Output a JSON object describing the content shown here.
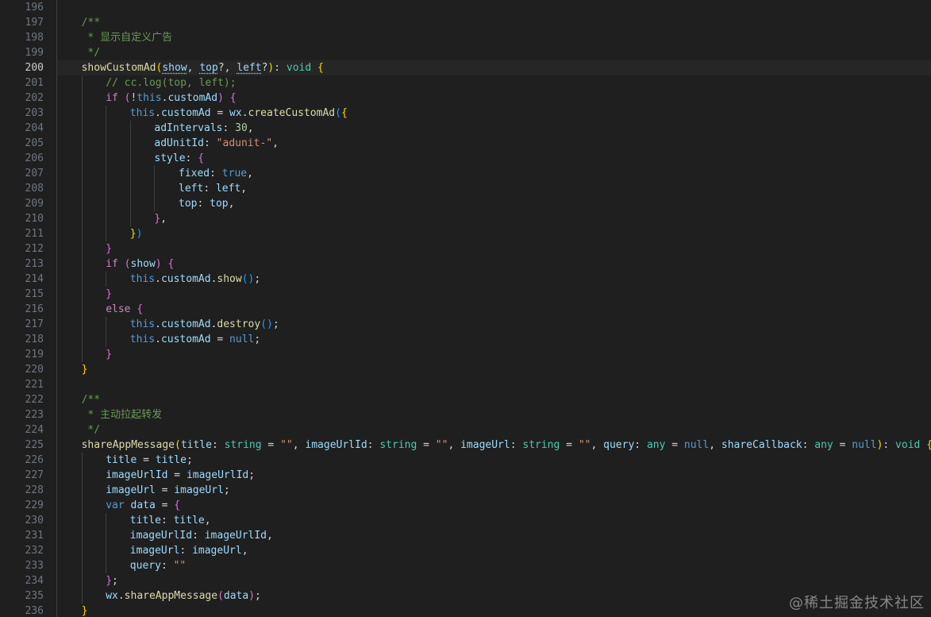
{
  "editor": {
    "theme": {
      "background": "#1f1f1f",
      "line_number": "#6e7681",
      "keyword": "#569cd6",
      "control": "#c586c0",
      "function": "#dcdcaa",
      "variable": "#9cdcfe",
      "type": "#4ec9b0",
      "string": "#ce9178",
      "number": "#b5cea8",
      "comment": "#6a9955",
      "punct": "#d4d4d4",
      "bracket1": "#ffd700",
      "bracket2": "#da70d6",
      "bracket3": "#179fff"
    },
    "active_line": 200,
    "lines": [
      {
        "n": "196",
        "indent": 0,
        "tokens": []
      },
      {
        "n": "197",
        "indent": 1,
        "tokens": [
          [
            "/**",
            "comment"
          ]
        ]
      },
      {
        "n": "198",
        "indent": 1,
        "tokens": [
          [
            " * 显示自定义广告",
            "comment"
          ]
        ]
      },
      {
        "n": "199",
        "indent": 1,
        "tokens": [
          [
            " */",
            "comment"
          ]
        ]
      },
      {
        "n": "200",
        "indent": 1,
        "tokens": [
          [
            "showCustomAd",
            "function"
          ],
          [
            "(",
            "bracket1"
          ],
          [
            "show",
            "variable",
            "squiggle"
          ],
          [
            ", ",
            "punct"
          ],
          [
            "top",
            "variable",
            "squiggle"
          ],
          [
            "?, ",
            "punct"
          ],
          [
            "left",
            "variable",
            "squiggle"
          ],
          [
            "?",
            "punct"
          ],
          [
            ")",
            "bracket1"
          ],
          [
            ": ",
            "punct"
          ],
          [
            "void",
            "type"
          ],
          [
            " ",
            "punct"
          ],
          [
            "{",
            "bracket1"
          ]
        ]
      },
      {
        "n": "201",
        "indent": 2,
        "tokens": [
          [
            "// cc.log(top, left);",
            "comment"
          ]
        ]
      },
      {
        "n": "202",
        "indent": 2,
        "tokens": [
          [
            "if",
            "control"
          ],
          [
            " ",
            "punct"
          ],
          [
            "(",
            "bracket2"
          ],
          [
            "!",
            "punct"
          ],
          [
            "this",
            "keyword"
          ],
          [
            ".",
            "punct"
          ],
          [
            "customAd",
            "variable"
          ],
          [
            ")",
            "bracket2"
          ],
          [
            " ",
            "punct"
          ],
          [
            "{",
            "bracket2"
          ]
        ]
      },
      {
        "n": "203",
        "indent": 3,
        "tokens": [
          [
            "this",
            "keyword"
          ],
          [
            ".",
            "punct"
          ],
          [
            "customAd",
            "variable"
          ],
          [
            " = ",
            "punct"
          ],
          [
            "wx",
            "variable"
          ],
          [
            ".",
            "punct"
          ],
          [
            "createCustomAd",
            "function"
          ],
          [
            "(",
            "bracket3"
          ],
          [
            "{",
            "bracket1"
          ]
        ]
      },
      {
        "n": "204",
        "indent": 4,
        "tokens": [
          [
            "adIntervals",
            "variable"
          ],
          [
            ": ",
            "punct"
          ],
          [
            "30",
            "number"
          ],
          [
            ",",
            "punct"
          ]
        ]
      },
      {
        "n": "205",
        "indent": 4,
        "tokens": [
          [
            "adUnitId",
            "variable"
          ],
          [
            ": ",
            "punct"
          ],
          [
            "\"adunit-\"",
            "string"
          ],
          [
            ",",
            "punct"
          ]
        ]
      },
      {
        "n": "206",
        "indent": 4,
        "tokens": [
          [
            "style",
            "variable"
          ],
          [
            ": ",
            "punct"
          ],
          [
            "{",
            "bracket2"
          ]
        ]
      },
      {
        "n": "207",
        "indent": 5,
        "tokens": [
          [
            "fixed",
            "variable"
          ],
          [
            ": ",
            "punct"
          ],
          [
            "true",
            "keyword"
          ],
          [
            ",",
            "punct"
          ]
        ]
      },
      {
        "n": "208",
        "indent": 5,
        "tokens": [
          [
            "left",
            "variable"
          ],
          [
            ": ",
            "punct"
          ],
          [
            "left",
            "variable"
          ],
          [
            ",",
            "punct"
          ]
        ]
      },
      {
        "n": "209",
        "indent": 5,
        "tokens": [
          [
            "top",
            "variable"
          ],
          [
            ": ",
            "punct"
          ],
          [
            "top",
            "variable"
          ],
          [
            ",",
            "punct"
          ]
        ]
      },
      {
        "n": "210",
        "indent": 4,
        "tokens": [
          [
            "}",
            "bracket2"
          ],
          [
            ",",
            "punct"
          ]
        ]
      },
      {
        "n": "211",
        "indent": 3,
        "tokens": [
          [
            "}",
            "bracket1"
          ],
          [
            ")",
            "bracket3"
          ]
        ]
      },
      {
        "n": "212",
        "indent": 2,
        "tokens": [
          [
            "}",
            "bracket2"
          ]
        ]
      },
      {
        "n": "213",
        "indent": 2,
        "tokens": [
          [
            "if",
            "control"
          ],
          [
            " ",
            "punct"
          ],
          [
            "(",
            "bracket2"
          ],
          [
            "show",
            "variable"
          ],
          [
            ")",
            "bracket2"
          ],
          [
            " ",
            "punct"
          ],
          [
            "{",
            "bracket2"
          ]
        ]
      },
      {
        "n": "214",
        "indent": 3,
        "tokens": [
          [
            "this",
            "keyword"
          ],
          [
            ".",
            "punct"
          ],
          [
            "customAd",
            "variable"
          ],
          [
            ".",
            "punct"
          ],
          [
            "show",
            "function"
          ],
          [
            "()",
            "bracket3"
          ],
          [
            ";",
            "punct"
          ]
        ]
      },
      {
        "n": "215",
        "indent": 2,
        "tokens": [
          [
            "}",
            "bracket2"
          ]
        ]
      },
      {
        "n": "216",
        "indent": 2,
        "tokens": [
          [
            "else",
            "control"
          ],
          [
            " ",
            "punct"
          ],
          [
            "{",
            "bracket2"
          ]
        ]
      },
      {
        "n": "217",
        "indent": 3,
        "tokens": [
          [
            "this",
            "keyword"
          ],
          [
            ".",
            "punct"
          ],
          [
            "customAd",
            "variable"
          ],
          [
            ".",
            "punct"
          ],
          [
            "destroy",
            "function"
          ],
          [
            "()",
            "bracket3"
          ],
          [
            ";",
            "punct"
          ]
        ]
      },
      {
        "n": "218",
        "indent": 3,
        "tokens": [
          [
            "this",
            "keyword"
          ],
          [
            ".",
            "punct"
          ],
          [
            "customAd",
            "variable"
          ],
          [
            " = ",
            "punct"
          ],
          [
            "null",
            "keyword"
          ],
          [
            ";",
            "punct"
          ]
        ]
      },
      {
        "n": "219",
        "indent": 2,
        "tokens": [
          [
            "}",
            "bracket2"
          ]
        ]
      },
      {
        "n": "220",
        "indent": 1,
        "tokens": [
          [
            "}",
            "bracket1"
          ]
        ]
      },
      {
        "n": "221",
        "indent": 0,
        "tokens": []
      },
      {
        "n": "222",
        "indent": 1,
        "tokens": [
          [
            "/**",
            "comment"
          ]
        ]
      },
      {
        "n": "223",
        "indent": 1,
        "tokens": [
          [
            " * 主动拉起转发",
            "comment"
          ]
        ]
      },
      {
        "n": "224",
        "indent": 1,
        "tokens": [
          [
            " */",
            "comment"
          ]
        ]
      },
      {
        "n": "225",
        "indent": 1,
        "tokens": [
          [
            "shareAppMessage",
            "function"
          ],
          [
            "(",
            "bracket1"
          ],
          [
            "title",
            "variable"
          ],
          [
            ": ",
            "punct"
          ],
          [
            "string",
            "type"
          ],
          [
            " = ",
            "punct"
          ],
          [
            "\"\"",
            "string"
          ],
          [
            ", ",
            "punct"
          ],
          [
            "imageUrlId",
            "variable"
          ],
          [
            ": ",
            "punct"
          ],
          [
            "string",
            "type"
          ],
          [
            " = ",
            "punct"
          ],
          [
            "\"\"",
            "string"
          ],
          [
            ", ",
            "punct"
          ],
          [
            "imageUrl",
            "variable"
          ],
          [
            ": ",
            "punct"
          ],
          [
            "string",
            "type"
          ],
          [
            " = ",
            "punct"
          ],
          [
            "\"\"",
            "string"
          ],
          [
            ", ",
            "punct"
          ],
          [
            "query",
            "variable"
          ],
          [
            ": ",
            "punct"
          ],
          [
            "any",
            "type"
          ],
          [
            " = ",
            "punct"
          ],
          [
            "null",
            "keyword"
          ],
          [
            ", ",
            "punct"
          ],
          [
            "shareCallback",
            "variable"
          ],
          [
            ": ",
            "punct"
          ],
          [
            "any",
            "type"
          ],
          [
            " = ",
            "punct"
          ],
          [
            "null",
            "keyword"
          ],
          [
            ")",
            "bracket1"
          ],
          [
            ": ",
            "punct"
          ],
          [
            "void",
            "type"
          ],
          [
            " ",
            "punct"
          ],
          [
            "{",
            "bracket1"
          ]
        ]
      },
      {
        "n": "226",
        "indent": 2,
        "tokens": [
          [
            "title",
            "variable"
          ],
          [
            " = ",
            "punct"
          ],
          [
            "title",
            "variable"
          ],
          [
            ";",
            "punct"
          ]
        ]
      },
      {
        "n": "227",
        "indent": 2,
        "tokens": [
          [
            "imageUrlId",
            "variable"
          ],
          [
            " = ",
            "punct"
          ],
          [
            "imageUrlId",
            "variable"
          ],
          [
            ";",
            "punct"
          ]
        ]
      },
      {
        "n": "228",
        "indent": 2,
        "tokens": [
          [
            "imageUrl",
            "variable"
          ],
          [
            " = ",
            "punct"
          ],
          [
            "imageUrl",
            "variable"
          ],
          [
            ";",
            "punct"
          ]
        ]
      },
      {
        "n": "229",
        "indent": 2,
        "tokens": [
          [
            "var",
            "keyword"
          ],
          [
            " ",
            "punct"
          ],
          [
            "data",
            "variable"
          ],
          [
            " = ",
            "punct"
          ],
          [
            "{",
            "bracket2"
          ]
        ]
      },
      {
        "n": "230",
        "indent": 3,
        "tokens": [
          [
            "title",
            "variable"
          ],
          [
            ": ",
            "punct"
          ],
          [
            "title",
            "variable"
          ],
          [
            ",",
            "punct"
          ]
        ]
      },
      {
        "n": "231",
        "indent": 3,
        "tokens": [
          [
            "imageUrlId",
            "variable"
          ],
          [
            ": ",
            "punct"
          ],
          [
            "imageUrlId",
            "variable"
          ],
          [
            ",",
            "punct"
          ]
        ]
      },
      {
        "n": "232",
        "indent": 3,
        "tokens": [
          [
            "imageUrl",
            "variable"
          ],
          [
            ": ",
            "punct"
          ],
          [
            "imageUrl",
            "variable"
          ],
          [
            ",",
            "punct"
          ]
        ]
      },
      {
        "n": "233",
        "indent": 3,
        "tokens": [
          [
            "query",
            "variable"
          ],
          [
            ": ",
            "punct"
          ],
          [
            "\"\"",
            "string"
          ]
        ]
      },
      {
        "n": "234",
        "indent": 2,
        "tokens": [
          [
            "}",
            "bracket2"
          ],
          [
            ";",
            "punct"
          ]
        ]
      },
      {
        "n": "235",
        "indent": 2,
        "tokens": [
          [
            "wx",
            "variable"
          ],
          [
            ".",
            "punct"
          ],
          [
            "shareAppMessage",
            "function"
          ],
          [
            "(",
            "bracket2"
          ],
          [
            "data",
            "variable"
          ],
          [
            ")",
            "bracket2"
          ],
          [
            ";",
            "punct"
          ]
        ]
      },
      {
        "n": "236",
        "indent": 1,
        "tokens": [
          [
            "}",
            "bracket1"
          ]
        ]
      }
    ]
  },
  "watermark": "@稀土掘金技术社区"
}
